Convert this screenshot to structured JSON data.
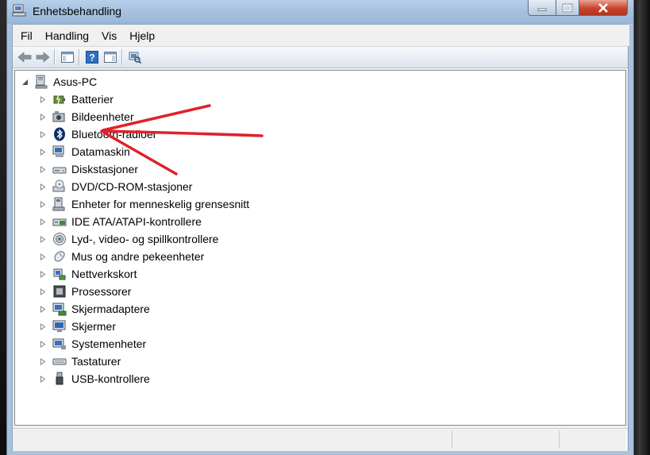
{
  "window": {
    "title": "Enhetsbehandling"
  },
  "menu": [
    "Fil",
    "Handling",
    "Vis",
    "Hjelp"
  ],
  "tree": {
    "root": "Asus-PC",
    "items": [
      {
        "label": "Batterier",
        "icon": "battery-icon"
      },
      {
        "label": "Bildeenheter",
        "icon": "camera-icon"
      },
      {
        "label": "Bluetooth-radioer",
        "icon": "bluetooth-icon"
      },
      {
        "label": "Datamaskin",
        "icon": "computer-icon"
      },
      {
        "label": "Diskstasjoner",
        "icon": "disk-drive-icon"
      },
      {
        "label": "DVD/CD-ROM-stasjoner",
        "icon": "optical-drive-icon"
      },
      {
        "label": "Enheter for menneskelig grensesnitt",
        "icon": "hid-icon"
      },
      {
        "label": "IDE ATA/ATAPI-kontrollere",
        "icon": "ide-controller-icon"
      },
      {
        "label": "Lyd-, video- og spillkontrollere",
        "icon": "speaker-icon"
      },
      {
        "label": "Mus og andre pekeenheter",
        "icon": "mouse-icon"
      },
      {
        "label": "Nettverkskort",
        "icon": "network-adapter-icon"
      },
      {
        "label": "Prosessorer",
        "icon": "processor-icon"
      },
      {
        "label": "Skjermadaptere",
        "icon": "display-adapter-icon"
      },
      {
        "label": "Skjermer",
        "icon": "monitor-icon"
      },
      {
        "label": "Systemenheter",
        "icon": "system-device-icon"
      },
      {
        "label": "Tastaturer",
        "icon": "keyboard-icon"
      },
      {
        "label": "USB-kontrollere",
        "icon": "usb-icon"
      }
    ]
  },
  "annotation": {
    "color": "#e0212b"
  }
}
